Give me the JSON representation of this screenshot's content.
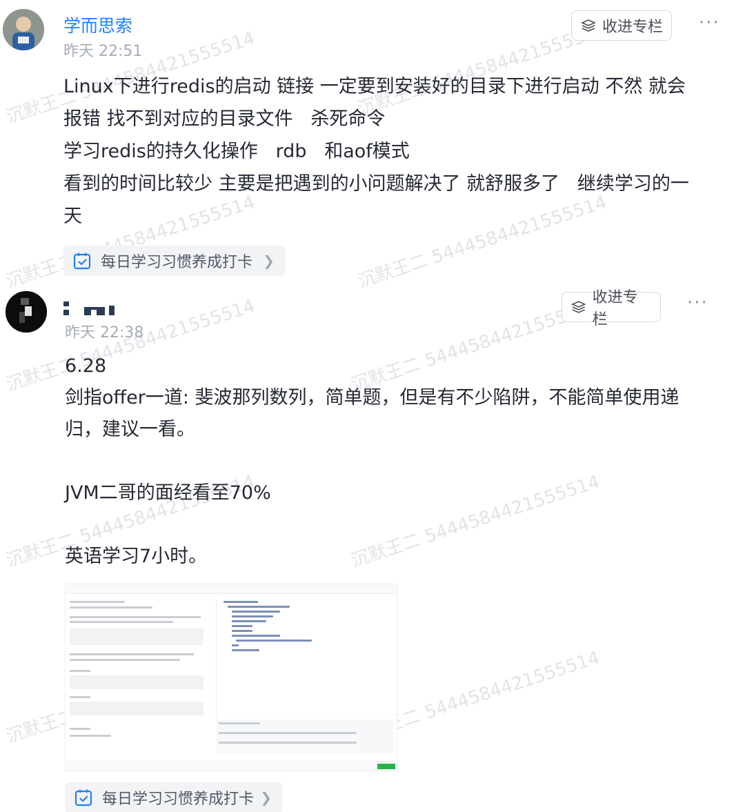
{
  "colors": {
    "accent": "#1e80ff",
    "text": "#252933",
    "muted": "#a6acb6",
    "topic_bg": "#f2f3f5"
  },
  "watermark_text": "沉默王二 5444584421555514",
  "posts": [
    {
      "username": "学而思索",
      "time": "昨天 22:51",
      "collect_label": "收进专栏",
      "more_label": "···",
      "lines": [
        "Linux下进行redis的启动 链接 一定要到安装好的目录下进行启动 不然 就会",
        "报错 找不到对应的目录文件   杀死命令",
        "学习redis的持久化操作   rdb   和aof模式",
        "看到的时间比较少 主要是把遇到的小问题解决了 就舒服多了   继续学习的一",
        "天"
      ],
      "topic": "每日学习习惯养成打卡",
      "topic_icon": "calendar-check-icon"
    },
    {
      "username": "",
      "time": "昨天 22:38",
      "collect_label": "收进专栏",
      "more_label": "···",
      "lines": [
        "6.28",
        "剑指offer一道: 斐波那列数列，简单题，但是有不少陷阱，不能简单使用递",
        "归，建议一看。",
        "JVM二哥的面经看至70%",
        "英语学习7小时。"
      ],
      "topic": "每日学习习惯养成打卡",
      "topic_icon": "calendar-check-icon"
    }
  ]
}
